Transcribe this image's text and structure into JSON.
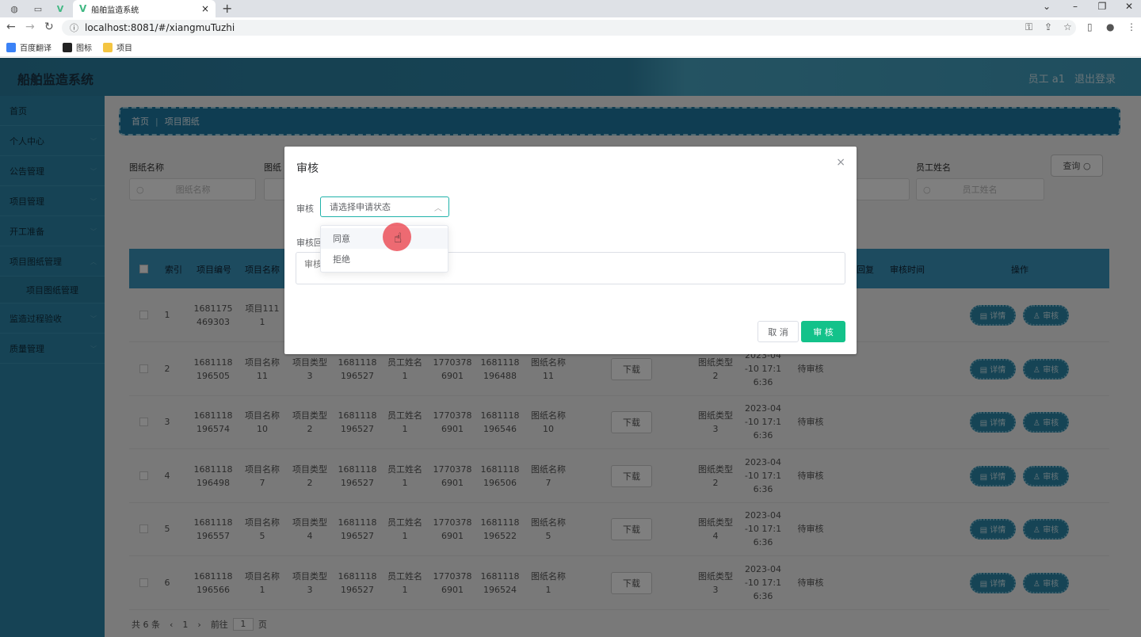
{
  "browser": {
    "tab_title": "船舶监造系统",
    "tab_close": "×",
    "new_tab": "+",
    "url": "localhost:8081/#/xiangmuTuzhi",
    "bookmarks": [
      "百度翻译",
      "图标",
      "项目"
    ]
  },
  "header": {
    "title": "船舶监造系统",
    "user": "员工 a1",
    "logout": "退出登录"
  },
  "sidebar": {
    "items": [
      "首页",
      "个人中心",
      "公告管理",
      "项目管理",
      "开工准备",
      "项目图纸管理"
    ],
    "sub_item": "项目图纸管理",
    "items_after": [
      "监造过程验收",
      "质量管理"
    ]
  },
  "breadcrumb": {
    "home": "首页",
    "sep": "|",
    "current": "项目图纸"
  },
  "filters": {
    "label1": "图纸名称",
    "placeholder1": "图纸名称",
    "label2": "图纸",
    "label_staff": "员工姓名",
    "placeholder_staff": "员工姓名",
    "query_button": "查询"
  },
  "table": {
    "headers": [
      "索引",
      "项目编号",
      "项目名称",
      "回复",
      "审核时间",
      "操作"
    ],
    "rows": [
      {
        "idx": "1",
        "pno": "1681175\n469303",
        "pname": "项目111\n1"
      },
      {
        "idx": "2",
        "pno": "1681118\n196505",
        "pname": "项目名称\n11",
        "ptype": "项目类型\n3",
        "c4": "1681118\n196527",
        "staff": "员工姓名\n1",
        "phone": "1770378\n6901",
        "c7": "1681118\n196488",
        "dname": "图纸名称\n11",
        "dtype": "图纸类型\n2",
        "time": "2023-04\n-10 17:1\n6:36",
        "status": "待审核"
      },
      {
        "idx": "3",
        "pno": "1681118\n196574",
        "pname": "项目名称\n10",
        "ptype": "项目类型\n2",
        "c4": "1681118\n196527",
        "staff": "员工姓名\n1",
        "phone": "1770378\n6901",
        "c7": "1681118\n196546",
        "dname": "图纸名称\n10",
        "dtype": "图纸类型\n3",
        "time": "2023-04\n-10 17:1\n6:36",
        "status": "待审核"
      },
      {
        "idx": "4",
        "pno": "1681118\n196498",
        "pname": "项目名称\n7",
        "ptype": "项目类型\n2",
        "c4": "1681118\n196527",
        "staff": "员工姓名\n1",
        "phone": "1770378\n6901",
        "c7": "1681118\n196506",
        "dname": "图纸名称\n7",
        "dtype": "图纸类型\n2",
        "time": "2023-04\n-10 17:1\n6:36",
        "status": "待审核"
      },
      {
        "idx": "5",
        "pno": "1681118\n196557",
        "pname": "项目名称\n5",
        "ptype": "项目类型\n4",
        "c4": "1681118\n196527",
        "staff": "员工姓名\n1",
        "phone": "1770378\n6901",
        "c7": "1681118\n196522",
        "dname": "图纸名称\n5",
        "dtype": "图纸类型\n4",
        "time": "2023-04\n-10 17:1\n6:36",
        "status": "待审核"
      },
      {
        "idx": "6",
        "pno": "1681118\n196566",
        "pname": "项目名称\n1",
        "ptype": "项目类型\n3",
        "c4": "1681118\n196527",
        "staff": "员工姓名\n1",
        "phone": "1770378\n6901",
        "c7": "1681118\n196524",
        "dname": "图纸名称\n1",
        "dtype": "图纸类型\n3",
        "time": "2023-04\n-10 17:1\n6:36",
        "status": "待审核"
      }
    ],
    "download_label": "下载",
    "detail_label": "详情",
    "audit_label": "审核"
  },
  "pager": {
    "total": "共 6 条",
    "page": "1",
    "goto": "前往",
    "goto_value": "1",
    "page_unit": "页"
  },
  "dialog": {
    "title": "审核",
    "close": "×",
    "audit_label": "审核",
    "select_placeholder": "请选择申请状态",
    "reply_label": "审核回",
    "reply_placeholder": "审核",
    "cancel": "取 消",
    "submit": "审 核",
    "options": [
      "同意",
      "拒绝"
    ]
  },
  "colors": {
    "header": "#2f86a8",
    "sidebar": "#2c87aa",
    "accent_green": "#13c28a",
    "select_border": "#20b2aa"
  }
}
